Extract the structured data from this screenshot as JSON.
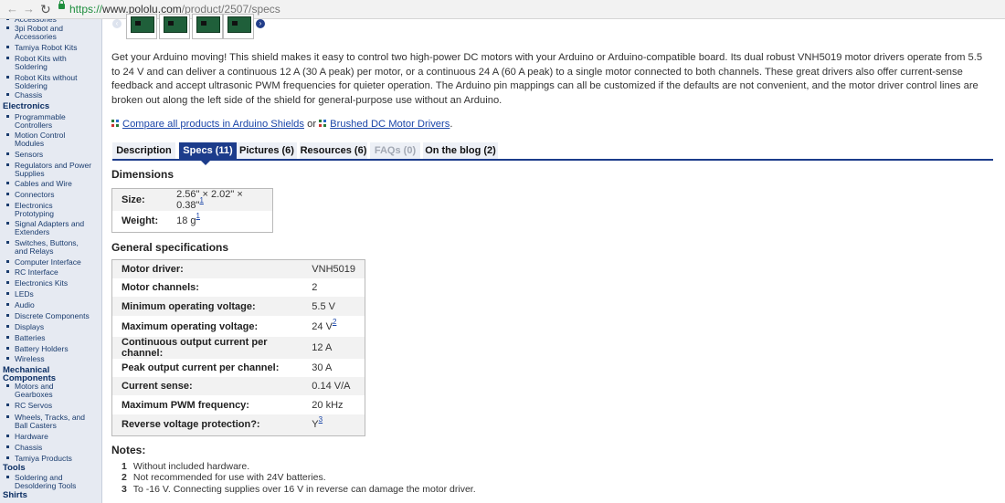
{
  "browser": {
    "url_scheme": "https://",
    "url_host": "www.pololu.com",
    "url_path": "/product/2507/specs"
  },
  "sidebar": {
    "items": [
      {
        "type": "item",
        "label": "Accessories"
      },
      {
        "type": "item",
        "label": "3pi Robot and Accessories"
      },
      {
        "type": "item",
        "label": "Tamiya Robot Kits"
      },
      {
        "type": "item",
        "label": "Robot Kits with Soldering"
      },
      {
        "type": "item",
        "label": "Robot Kits without Soldering"
      },
      {
        "type": "item",
        "label": "Chassis"
      },
      {
        "type": "head",
        "label": "Electronics"
      },
      {
        "type": "item",
        "label": "Programmable Controllers"
      },
      {
        "type": "item",
        "label": "Motion Control Modules"
      },
      {
        "type": "item",
        "label": "Sensors"
      },
      {
        "type": "item",
        "label": "Regulators and Power Supplies"
      },
      {
        "type": "item",
        "label": "Cables and Wire"
      },
      {
        "type": "item",
        "label": "Connectors"
      },
      {
        "type": "item",
        "label": "Electronics Prototyping"
      },
      {
        "type": "item",
        "label": "Signal Adapters and Extenders"
      },
      {
        "type": "item",
        "label": "Switches, Buttons, and Relays"
      },
      {
        "type": "item",
        "label": "Computer Interface"
      },
      {
        "type": "item",
        "label": "RC Interface"
      },
      {
        "type": "item",
        "label": "Electronics Kits"
      },
      {
        "type": "item",
        "label": "LEDs"
      },
      {
        "type": "item",
        "label": "Audio"
      },
      {
        "type": "item",
        "label": "Discrete Components"
      },
      {
        "type": "item",
        "label": "Displays"
      },
      {
        "type": "item",
        "label": "Batteries"
      },
      {
        "type": "item",
        "label": "Battery Holders"
      },
      {
        "type": "item",
        "label": "Wireless"
      },
      {
        "type": "head",
        "label": "Mechanical Components"
      },
      {
        "type": "item",
        "label": "Motors and Gearboxes"
      },
      {
        "type": "item",
        "label": "RC Servos"
      },
      {
        "type": "item",
        "label": "Wheels, Tracks, and Ball Casters"
      },
      {
        "type": "item",
        "label": "Hardware"
      },
      {
        "type": "item",
        "label": "Chassis"
      },
      {
        "type": "item",
        "label": "Tamiya Products"
      },
      {
        "type": "head",
        "label": "Tools"
      },
      {
        "type": "item",
        "label": "Soldering and Desoldering Tools"
      },
      {
        "type": "head",
        "label": "Shirts"
      }
    ]
  },
  "intro": "Get your Arduino moving! This shield makes it easy to control two high-power DC motors with your Arduino or Arduino-compatible board. Its dual robust VNH5019 motor drivers operate from 5.5 to 24 V and can deliver a continuous 12 A (30 A peak) per motor, or a continuous 24 A (60 A peak) to a single motor connected to both channels. These great drivers also offer current-sense feedback and accept ultrasonic PWM frequencies for quieter operation. The Arduino pin mappings can all be customized if the defaults are not convenient, and the motor driver control lines are broken out along the left side of the shield for general-purpose use without an Arduino.",
  "compare": {
    "link1": "Compare all products in Arduino Shields",
    "or": "or",
    "link2": "Brushed DC Motor Drivers",
    "end": "."
  },
  "tabs": [
    {
      "label": "Description",
      "state": "normal"
    },
    {
      "label": "Specs (11)",
      "state": "active"
    },
    {
      "label": "Pictures (6)",
      "state": "normal"
    },
    {
      "label": "Resources (6)",
      "state": "normal"
    },
    {
      "label": "FAQs (0)",
      "state": "disabled"
    },
    {
      "label": "On the blog (2)",
      "state": "normal"
    }
  ],
  "dimensions": {
    "title": "Dimensions",
    "rows": [
      {
        "key": "Size:",
        "value": "2.56\" × 2.02\" × 0.38\"",
        "note": "1"
      },
      {
        "key": "Weight:",
        "value": "18 g",
        "note": "1"
      }
    ]
  },
  "general": {
    "title": "General specifications",
    "rows": [
      {
        "key": "Motor driver:",
        "value": "VNH5019",
        "note": ""
      },
      {
        "key": "Motor channels:",
        "value": "2",
        "note": ""
      },
      {
        "key": "Minimum operating voltage:",
        "value": "5.5 V",
        "note": ""
      },
      {
        "key": "Maximum operating voltage:",
        "value": "24 V",
        "note": "2"
      },
      {
        "key": "Continuous output current per channel:",
        "value": "12 A",
        "note": ""
      },
      {
        "key": "Peak output current per channel:",
        "value": "30 A",
        "note": ""
      },
      {
        "key": "Current sense:",
        "value": "0.14 V/A",
        "note": ""
      },
      {
        "key": "Maximum PWM frequency:",
        "value": "20 kHz",
        "note": ""
      },
      {
        "key": "Reverse voltage protection?:",
        "value": "Y",
        "note": "3"
      }
    ]
  },
  "notes": {
    "title": "Notes:",
    "items": [
      {
        "num": "1",
        "text": "Without included hardware."
      },
      {
        "num": "2",
        "text": "Not recommended for use with 24V batteries."
      },
      {
        "num": "3",
        "text": "To -16 V. Connecting supplies over 16 V in reverse can damage the motor driver."
      }
    ]
  },
  "colors": {
    "sidebar_bg": "#e6eaf2",
    "tab_active": "#1c3c8b",
    "link": "#1a45a8"
  }
}
